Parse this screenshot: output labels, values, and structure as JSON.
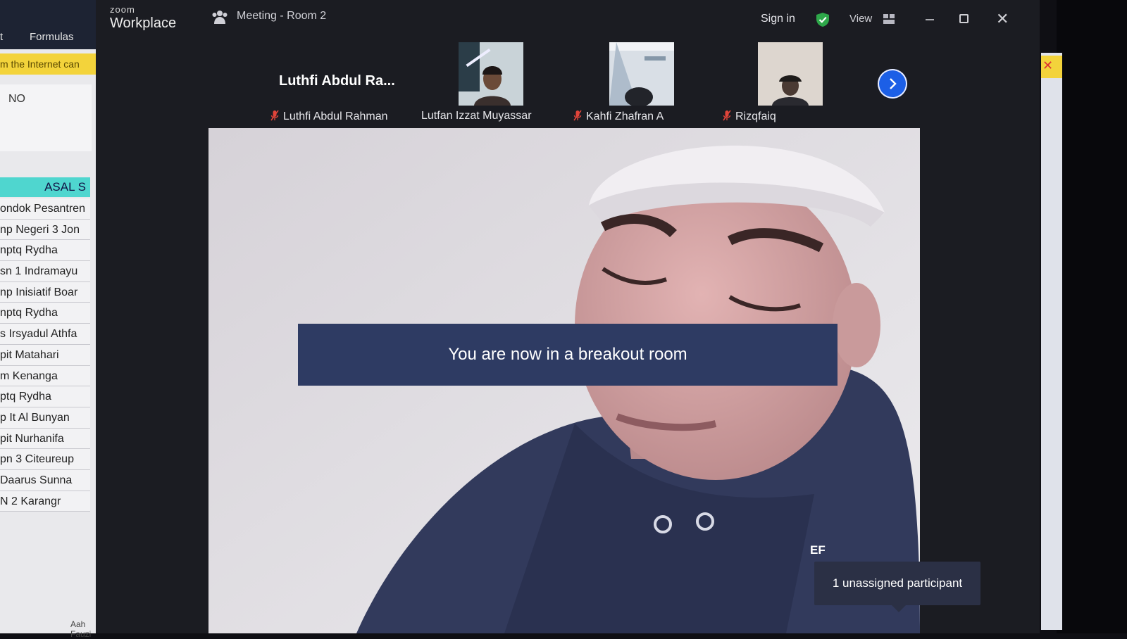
{
  "spreadsheet": {
    "tab_partial": "t",
    "tab_formulas": "Formulas",
    "warning_text": "m the Internet can",
    "header_no": "NO",
    "column_header": "ASAL S",
    "rows": [
      "ondok Pesantren",
      "np Negeri 3 Jon",
      "nptq Rydha",
      "sn 1 Indramayu",
      "np Inisiatif Boar",
      "nptq Rydha",
      "s Irsyadul Athfa",
      "pit Matahari",
      "m Kenanga",
      "ptq Rydha",
      "p It Al Bunyan",
      "pit Nurhanifa",
      "pn 3 Citeureup",
      "Daarus Sunna",
      "N 2 Karangr"
    ],
    "footer_text": "Aah Fauzi"
  },
  "zoom": {
    "brand_small": "zoom",
    "brand": "Workplace",
    "meeting_title": "Meeting - Room 2",
    "sign_in": "Sign in",
    "view_label": "View",
    "active_speaker": "Luthfi Abdul Ra...",
    "participants": [
      {
        "name": "Luthfi Abdul Rahman",
        "muted": true
      },
      {
        "name": "Lutfan Izzat Muyassar",
        "muted": false
      },
      {
        "name": "Kahfi Zhafran A",
        "muted": true
      },
      {
        "name": "Rizqfaiq",
        "muted": true
      }
    ],
    "banner": "You are now in a breakout room",
    "initials": "EF",
    "tooltip": "1 unassigned participant",
    "colors": {
      "accent_blue": "#1c5fe6",
      "banner_bg": "#2e3b63",
      "shield_green": "#2ea84a",
      "muted_red": "#e0443a"
    }
  }
}
